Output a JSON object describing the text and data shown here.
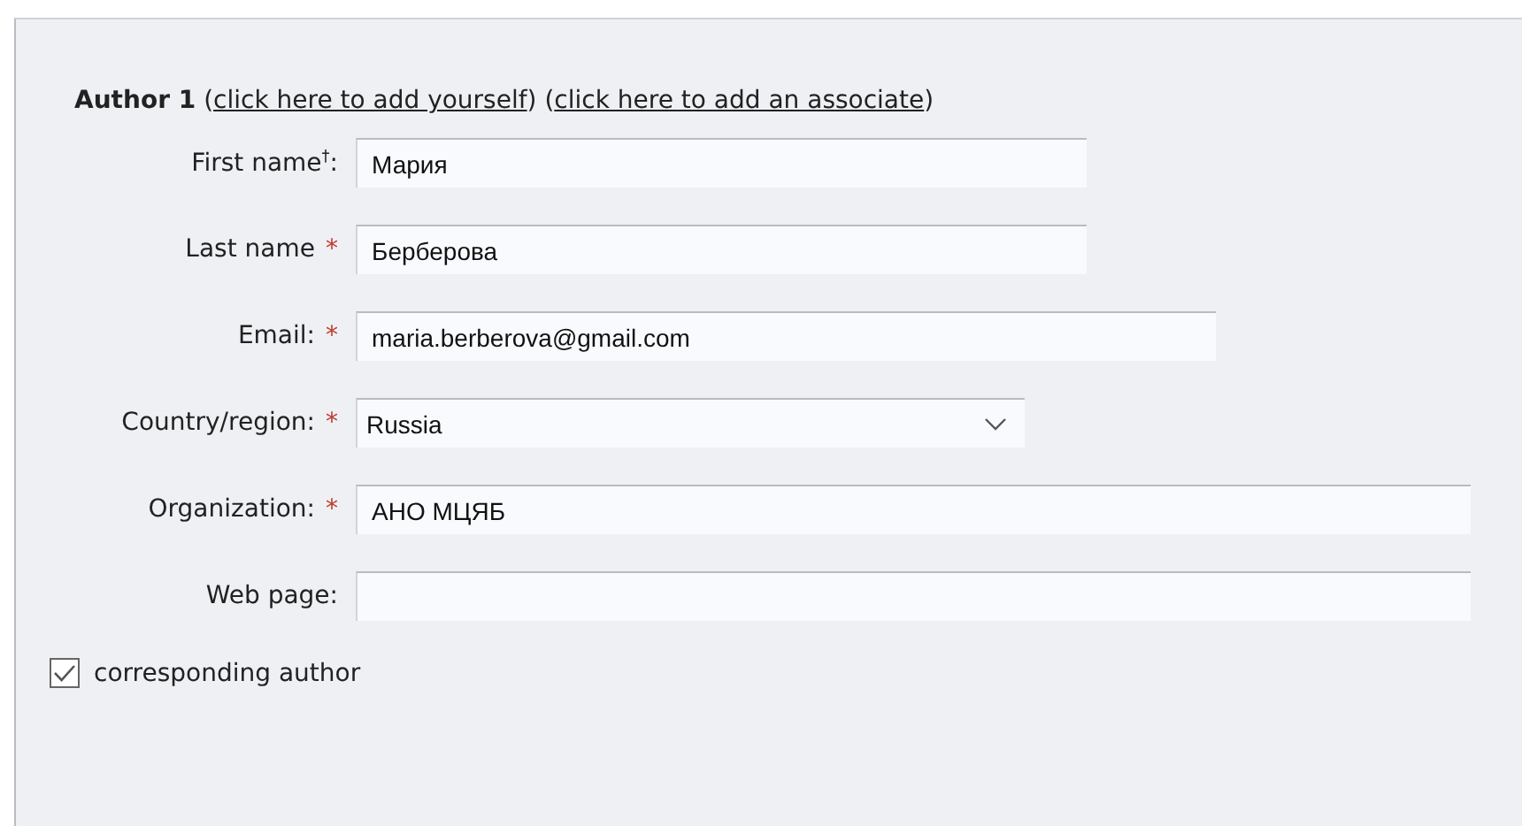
{
  "heading": [
    {
      "kind": "bold",
      "text": "Author 1"
    },
    {
      "kind": "plain",
      "text": "("
    },
    {
      "kind": "link",
      "text": "click here to add yourself"
    },
    {
      "kind": "plain",
      "text": ")"
    },
    {
      "kind": "plain",
      "text": "("
    },
    {
      "kind": "link",
      "text": "click here to add an associate"
    },
    {
      "kind": "plain",
      "text": ")"
    }
  ],
  "fields": [
    {
      "kind": "text",
      "label": "First name$^{†}$:",
      "value": "Мария"
    },
    {
      "kind": "text",
      "label": "Last name",
      "required_mark": "*",
      "value": "Берберова"
    },
    {
      "kind": "text",
      "label": "Email:",
      "required_mark": "*",
      "value": "maria.berberova@gmail.com"
    },
    {
      "kind": "select",
      "label": "Country/region:",
      "required_mark": "*",
      "value": "Russia"
    },
    {
      "kind": "text",
      "label": "Organization:",
      "required_mark": "*",
      "value": "АНО МЦЯБ"
    },
    {
      "kind": "text",
      "label": "Web page:"
    }
  ],
  "corresponding": {
    "label": "corresponding author",
    "checked": true
  }
}
